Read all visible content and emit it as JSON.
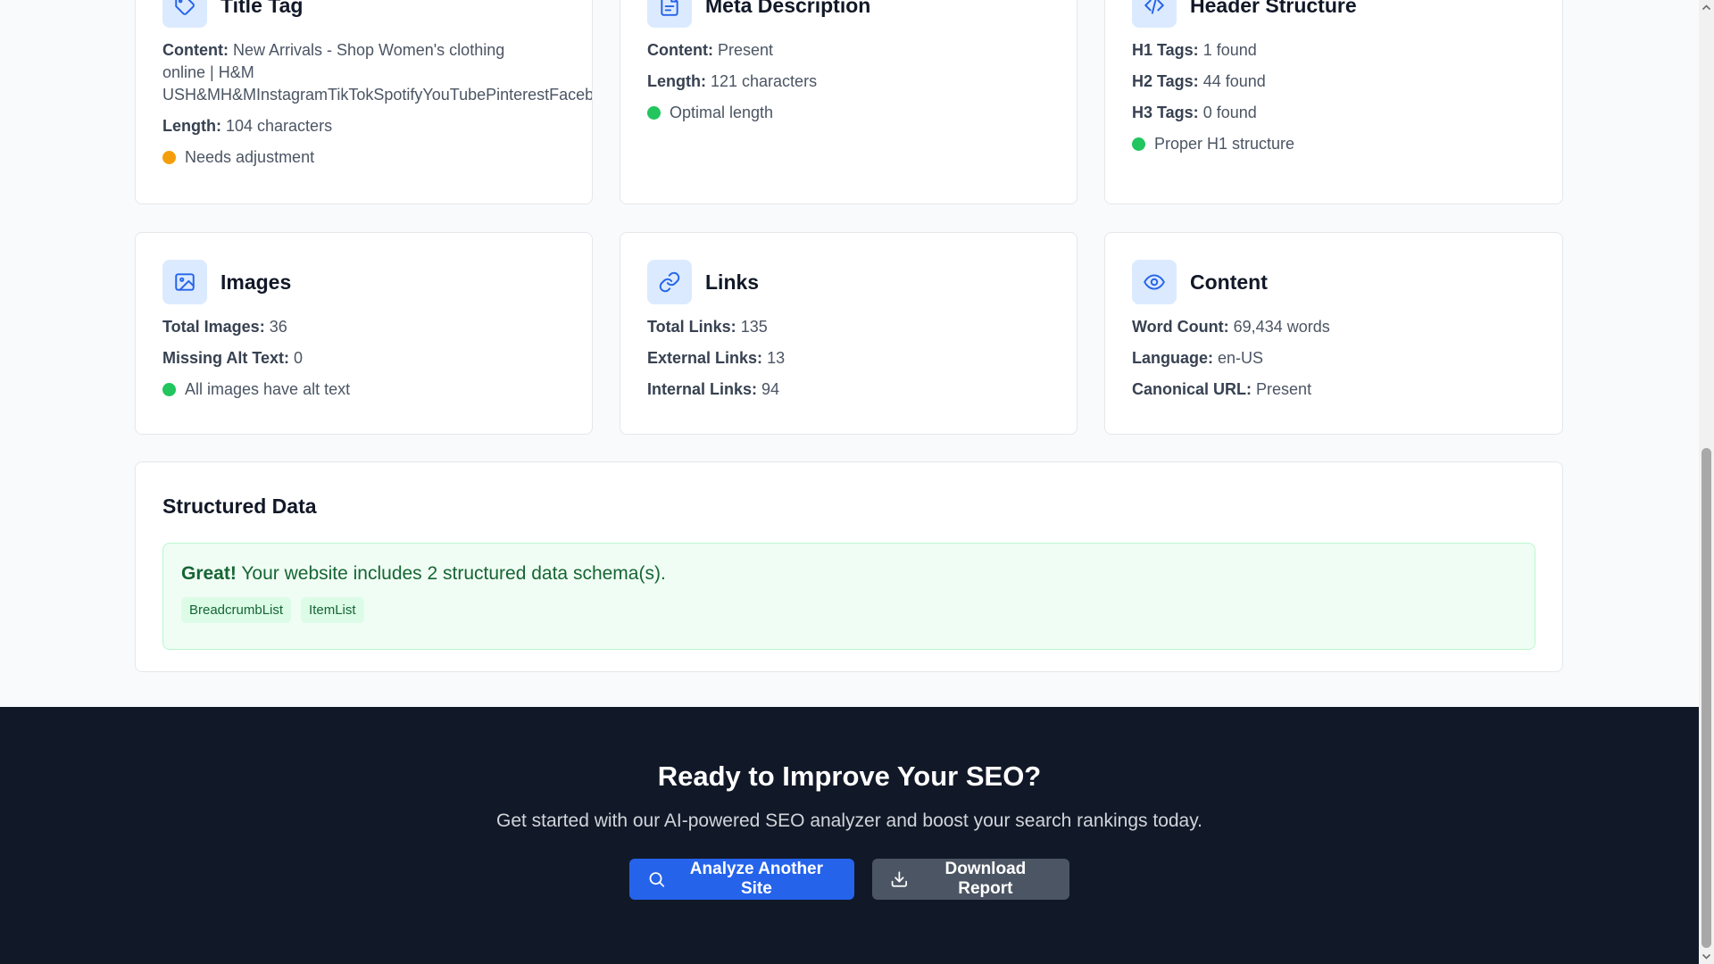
{
  "cards": {
    "title_tag": {
      "title": "Title Tag",
      "content_label": "Content:",
      "content_value_line1": "New Arrivals - Shop Women's clothing online | H&M",
      "content_value_line2": "USH&MH&MInstagramTikTokSpotifyYouTubePinterestFacebook",
      "length_label": "Length:",
      "length_value": "104 characters",
      "status": "Needs adjustment",
      "status_color": "#f59e0b"
    },
    "meta_description": {
      "title": "Meta Description",
      "content_label": "Content:",
      "content_value": "Present",
      "length_label": "Length:",
      "length_value": "121 characters",
      "status": "Optimal length",
      "status_color": "#22c55e"
    },
    "header_structure": {
      "title": "Header Structure",
      "h1_label": "H1 Tags:",
      "h1_value": "1 found",
      "h2_label": "H2 Tags:",
      "h2_value": "44 found",
      "h3_label": "H3 Tags:",
      "h3_value": "0 found",
      "status": "Proper H1 structure",
      "status_color": "#22c55e"
    },
    "images": {
      "title": "Images",
      "total_label": "Total Images:",
      "total_value": "36",
      "missing_label": "Missing Alt Text:",
      "missing_value": "0",
      "status": "All images have alt text",
      "status_color": "#22c55e"
    },
    "links": {
      "title": "Links",
      "total_label": "Total Links:",
      "total_value": "135",
      "external_label": "External Links:",
      "external_value": "13",
      "internal_label": "Internal Links:",
      "internal_value": "94"
    },
    "content": {
      "title": "Content",
      "word_label": "Word Count:",
      "word_value": "69,434 words",
      "language_label": "Language:",
      "language_value": "en-US",
      "canonical_label": "Canonical URL:",
      "canonical_value": "Present"
    }
  },
  "structured_data": {
    "title": "Structured Data",
    "msg_strong": "Great!",
    "msg_text": "Your website includes 2 structured data schema(s).",
    "schemas": [
      "BreadcrumbList",
      "ItemList"
    ]
  },
  "footer": {
    "title": "Ready to Improve Your SEO?",
    "subtitle": "Get started with our AI-powered SEO analyzer and boost your search rankings today.",
    "analyze_label": "Analyze Another Site",
    "download_label": "Download Report"
  },
  "icons": {
    "title_tag": "tag-icon",
    "meta_description": "document-icon",
    "header_structure": "code-icon",
    "images": "image-icon",
    "links": "link-icon",
    "content": "eye-icon",
    "analyze": "search-icon",
    "download": "download-icon"
  },
  "colors": {
    "accent": "#2563eb",
    "icon_bg": "#dbeafe",
    "footer_bg": "#111827",
    "success_bg": "#f0fdf4",
    "success_text": "#166534"
  }
}
